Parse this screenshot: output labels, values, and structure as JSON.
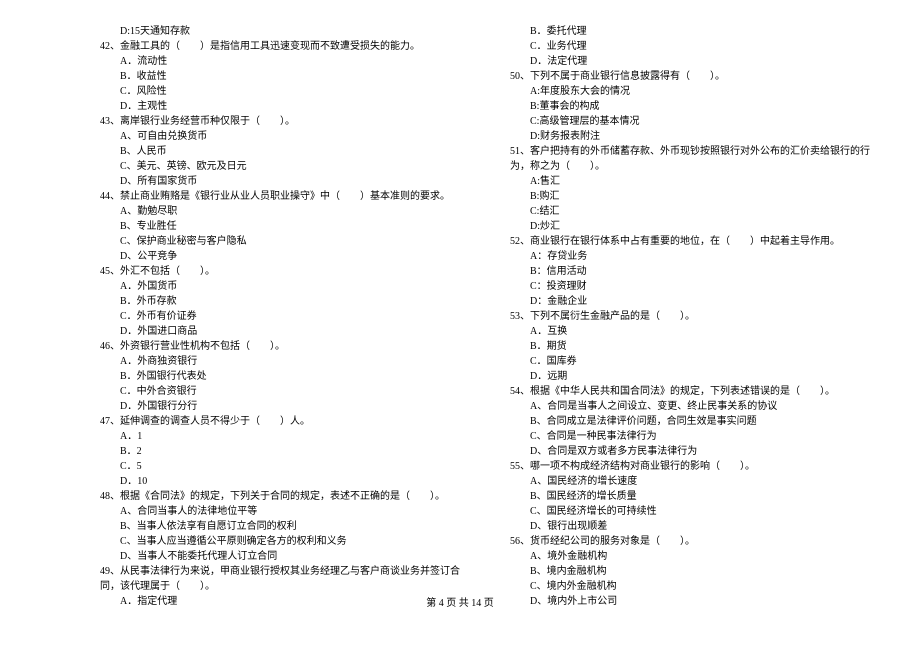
{
  "left": {
    "prevOpt": "D:15天通知存款",
    "q42": {
      "stem": "42、金融工具的（　　）是指信用工具迅速变现而不致遭受损失的能力。",
      "A": "A．流动性",
      "B": "B．收益性",
      "C": "C．风险性",
      "D": "D．主观性"
    },
    "q43": {
      "stem": "43、离岸银行业务经营币种仅限于（　　）。",
      "A": "A、可自由兑换货币",
      "B": "B、人民币",
      "C": "C、美元、英镑、欧元及日元",
      "D": "D、所有国家货币"
    },
    "q44": {
      "stem": "44、禁止商业贿赂是《银行业从业人员职业操守》中（　　）基本准则的要求。",
      "A": "A、勤勉尽职",
      "B": "B、专业胜任",
      "C": "C、保护商业秘密与客户隐私",
      "D": "D、公平竞争"
    },
    "q45": {
      "stem": "45、外汇不包括（　　）。",
      "A": "A．外国货币",
      "B": "B．外币存款",
      "C": "C．外币有价证券",
      "D": "D．外国进口商品"
    },
    "q46": {
      "stem": "46、外资银行营业性机构不包括（　　）。",
      "A": "A．外商独资银行",
      "B": "B．外国银行代表处",
      "C": "C．中外合资银行",
      "D": "D．外国银行分行"
    },
    "q47": {
      "stem": "47、延伸调查的调查人员不得少于（　　）人。",
      "A": "A．1",
      "B": "B．2",
      "C": "C．5",
      "D": "D．10"
    },
    "q48": {
      "stem": "48、根据《合同法》的规定，下列关于合同的规定，表述不正确的是（　　）。",
      "A": "A、合同当事人的法律地位平等",
      "B": "B、当事人依法享有自愿订立合同的权利",
      "C": "C、当事人应当遵循公平原则确定各方的权利和义务",
      "D": "D、当事人不能委托代理人订立合同"
    },
    "q49": {
      "stem": "49、从民事法律行为来说，甲商业银行授权其业务经理乙与客户商谈业务并签订合同，该代理属于（　　）。",
      "A": "A．指定代理"
    }
  },
  "right": {
    "q49r": {
      "B": "B．委托代理",
      "C": "C．业务代理",
      "D": "D．法定代理"
    },
    "q50": {
      "stem": "50、下列不属于商业银行信息披露得有（　　）。",
      "A": "A:年度股东大会的情况",
      "B": "B:董事会的构成",
      "C": "C:高级管理层的基本情况",
      "D": "D:财务报表附注"
    },
    "q51": {
      "stem": "51、客户把持有的外币储蓄存款、外币现钞按照银行对外公布的汇价卖给银行的行为，称之为（　　）。",
      "A": "A:售汇",
      "B": "B:购汇",
      "C": "C:结汇",
      "D": "D:炒汇"
    },
    "q52": {
      "stem": "52、商业银行在银行体系中占有重要的地位，在（　　）中起着主导作用。",
      "A": "A：存贷业务",
      "B": "B：信用活动",
      "C": "C：投资理财",
      "D": "D：金融企业"
    },
    "q53": {
      "stem": "53、下列不属衍生金融产品的是（　　）。",
      "A": "A．互换",
      "B": "B．期货",
      "C": "C．国库券",
      "D": "D．远期"
    },
    "q54": {
      "stem": "54、根据《中华人民共和国合同法》的规定，下列表述错误的是（　　）。",
      "A": "A、合同是当事人之间设立、变更、终止民事关系的协议",
      "B": "B、合同成立是法律评价问题，合同生效是事实问题",
      "C": "C、合同是一种民事法律行为",
      "D": "D、合同是双方或者多方民事法律行为"
    },
    "q55": {
      "stem": "55、哪一项不构成经济结构对商业银行的影响（　　）。",
      "A": "A、国民经济的增长速度",
      "B": "B、国民经济的增长质量",
      "C": "C、国民经济增长的可持续性",
      "D": "D、银行出现顺差"
    },
    "q56": {
      "stem": "56、货币经纪公司的服务对象是（　　）。",
      "A": "A、境外金融机构",
      "B": "B、境内金融机构",
      "C": "C、境内外金融机构",
      "D": "D、境内外上市公司"
    }
  },
  "footer": "第 4 页 共 14 页"
}
